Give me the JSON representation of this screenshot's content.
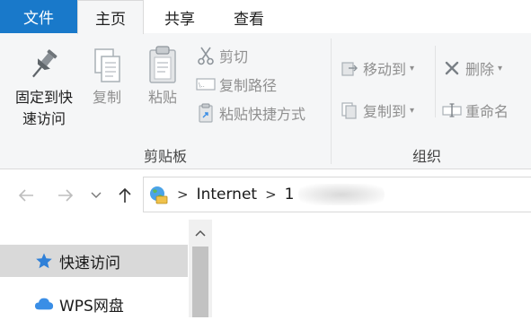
{
  "tabs": {
    "file": "文件",
    "home": "主页",
    "share": "共享",
    "view": "查看"
  },
  "ribbon": {
    "clipboard": {
      "group_label": "剪贴板",
      "pin_label_line1": "固定到快",
      "pin_label_line2": "速访问",
      "copy_label": "复制",
      "paste_label": "粘贴",
      "cut_label": "剪切",
      "copy_path_label": "复制路径",
      "paste_shortcut_label": "粘贴快捷方式"
    },
    "organize": {
      "group_label": "组织",
      "move_to_label": "移动到",
      "copy_to_label": "复制到",
      "delete_label": "删除",
      "rename_label": "重命名"
    }
  },
  "address": {
    "root": "Internet",
    "child_visible_prefix": "1"
  },
  "navpane": {
    "items": [
      {
        "label": "快速访问",
        "icon": "star-icon",
        "selected": true
      },
      {
        "label": "WPS网盘",
        "icon": "cloud-icon",
        "selected": false
      }
    ]
  },
  "colors": {
    "file_tab": "#1979ca",
    "ribbon_bg": "#f5f6f7",
    "selected_nav": "#d9d9d9",
    "star": "#2f80d8",
    "cloud": "#3a8ee6"
  }
}
